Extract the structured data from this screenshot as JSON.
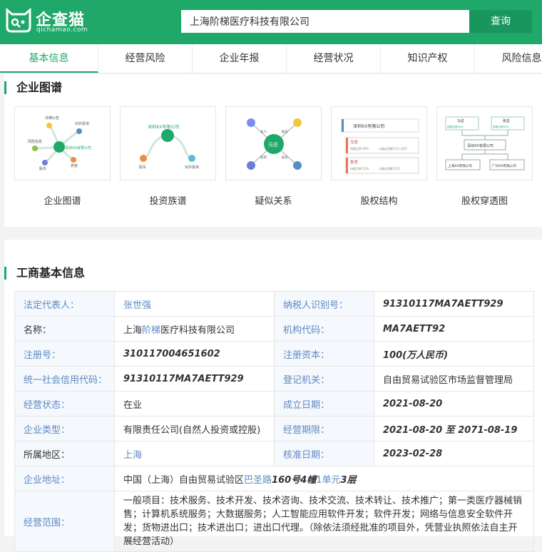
{
  "logo": {
    "title": "企查猫",
    "subtitle": "qichamao.com"
  },
  "search": {
    "value": "上海阶梯医疗科技有限公司",
    "button": "查询"
  },
  "tabs": [
    "基本信息",
    "经营风险",
    "企业年报",
    "经营状况",
    "知识产权",
    "风险信息"
  ],
  "graph_section": {
    "title": "企业图谱",
    "cards": [
      {
        "label": "企业图谱",
        "icon": "enterprise-graph-thumb"
      },
      {
        "label": "投资族谱",
        "icon": "investment-tree-thumb"
      },
      {
        "label": "疑似关系",
        "icon": "suspected-relation-thumb"
      },
      {
        "label": "股权结构",
        "icon": "equity-structure-thumb"
      },
      {
        "label": "股权穿透图",
        "icon": "equity-penetration-thumb"
      }
    ],
    "thumb_text": {
      "company": "深圳XX有限公司",
      "person_ma": "马总",
      "person_zhang": "张总",
      "shareholder": "股东",
      "legal": "法人",
      "invest": "投资",
      "ratio_ma": "持股比例:50%",
      "ratio_zhang": "持股比例:12%",
      "capital_ma": "认缴出资额:2万人民币",
      "capital_zhang": "认缴出资额:12万",
      "sh_ratio_a": "持股比例50%",
      "sh_ratio_b": "持股比例50%",
      "sub_sh": "上海XX有限公司",
      "sub_gz": "广州XX有限公司",
      "g1_a": "法律公告",
      "g1_b": "对外投资",
      "g1_c": "风险",
      "g1_d": "风险信息",
      "g1_e": "股东",
      "g1_f": "高管",
      "g2_a": "股东",
      "g2_b": "对外投资"
    }
  },
  "basic_section": {
    "title": "工商基本信息",
    "rows": [
      {
        "k1": "法定代表人：",
        "v1": "张世强",
        "k2": "纳税人识别号：",
        "v2": "91310117MA7AETT929"
      },
      {
        "k1": "名称：",
        "v1_a": "上海",
        "v1_b": "阶梯",
        "v1_c": "医疗科技有限公司",
        "k2": "机构代码：",
        "v2": "MA7AETT92"
      },
      {
        "k1": "注册号：",
        "v1": "310117004651602",
        "k2": "注册资本：",
        "v2": "100(万人民币)"
      },
      {
        "k1": "统一社会信用代码：",
        "v1": "91310117MA7AETT929",
        "k2": "登记机关：",
        "v2": "自由贸易试验区市场监督管理局"
      },
      {
        "k1": "经营状态：",
        "v1": "在业",
        "k2": "成立日期：",
        "v2": "2021-08-20"
      },
      {
        "k1": "企业类型：",
        "v1": "有限责任公司(自然人投资或控股)",
        "k2": "经营期限：",
        "v2": "2021-08-20 至 2071-08-19"
      },
      {
        "k1": "所属地区：",
        "v1": "上海",
        "k2": "核准日期：",
        "v2": "2023-02-28"
      }
    ],
    "address": {
      "label": "企业地址：",
      "p1": "中国（上海）自由贸易试验区",
      "p2": "巴圣路",
      "p3": "160号4幢",
      "p4": "1单元",
      "p5": "3层"
    },
    "scope": {
      "label": "经营范围：",
      "text": "一般项目：技术服务、技术开发、技术咨询、技术交流、技术转让、技术推广；第一类医疗器械销售；计算机系统服务；大数据服务；人工智能应用软件开发；软件开发；网络与信息安全软件开发；货物进出口；技术进出口；进出口代理。（除依法须经批准的项目外，凭营业执照依法自主开展经营活动）"
    }
  },
  "colors": {
    "brand": "#1fa86a",
    "link": "#5b8ac4"
  }
}
